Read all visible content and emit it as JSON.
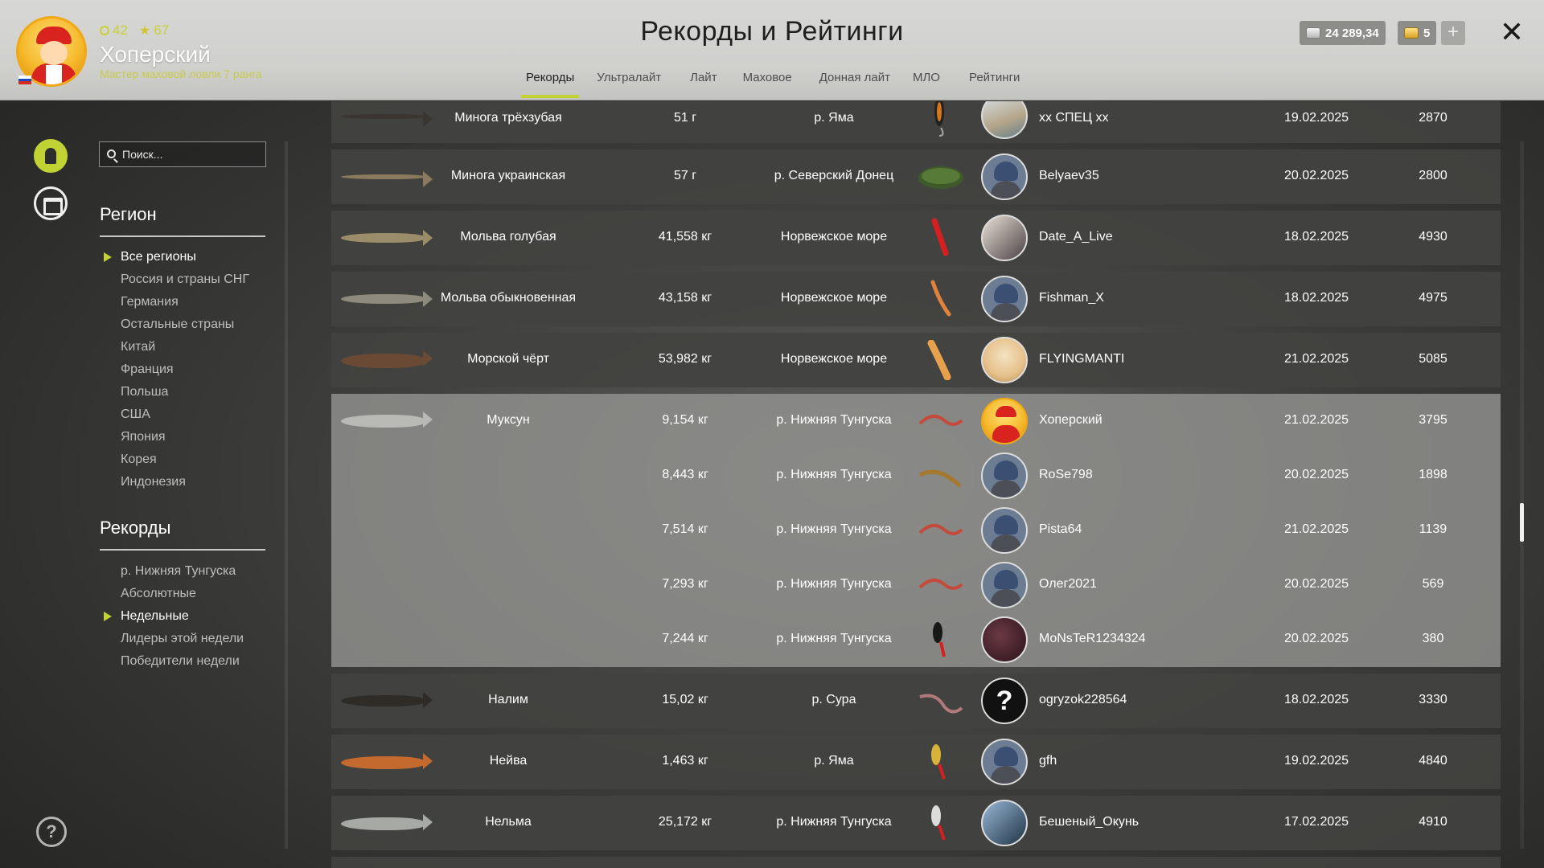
{
  "header": {
    "title": "Рекорды и Рейтинги",
    "player": {
      "level": "42",
      "stars": "67",
      "name": "Хоперский",
      "rank": "Мастер маховой ловли 7 ранга"
    },
    "currency": {
      "silver": "24 289,34",
      "gold": "5"
    },
    "plus_label": "+",
    "close_label": "✕"
  },
  "tabs": [
    "Рекорды",
    "Ультралайт",
    "Лайт",
    "Маховое",
    "Донная лайт",
    "МЛО",
    "Рейтинги"
  ],
  "active_tab": "Рекорды",
  "search": {
    "placeholder": "Поиск..."
  },
  "sidebar": {
    "region_title": "Регион",
    "regions": [
      "Все регионы",
      "Россия и страны СНГ",
      "Германия",
      "Остальные страны",
      "Китай",
      "Франция",
      "Польша",
      "США",
      "Япония",
      "Корея",
      "Индонезия"
    ],
    "records_title": "Рекорды",
    "records": [
      "р. Нижняя Тунгуска",
      "Абсолютные",
      "Недельные",
      "Лидеры этой недели",
      "Победители недели"
    ]
  },
  "help_label": "?",
  "rows": [
    {
      "fish": "Минога трёхзубая",
      "weight": "51 г",
      "place": "р. Яма",
      "player": "xx СПЕЦ xx",
      "date": "19.02.2025",
      "points": "2870"
    },
    {
      "fish": "Минога украинская",
      "weight": "57 г",
      "place": "р. Северский Донец",
      "player": "Belyaev35",
      "date": "20.02.2025",
      "points": "2800"
    },
    {
      "fish": "Мольва голубая",
      "weight": "41,558 кг",
      "place": "Норвежское море",
      "player": "Date_A_Live",
      "date": "18.02.2025",
      "points": "4930"
    },
    {
      "fish": "Мольва обыкновенная",
      "weight": "43,158 кг",
      "place": "Норвежское море",
      "player": "Fishman_X",
      "date": "18.02.2025",
      "points": "4975"
    },
    {
      "fish": "Морской чёрт",
      "weight": "53,982 кг",
      "place": "Норвежское море",
      "player": "FLYINGMANTI",
      "date": "21.02.2025",
      "points": "5085"
    },
    {
      "fish": "Муксун",
      "weight": "9,154 кг",
      "place": "р. Нижняя Тунгуска",
      "player": "Хоперский",
      "date": "21.02.2025",
      "points": "3795"
    },
    {
      "fish": "",
      "weight": "8,443 кг",
      "place": "р. Нижняя Тунгуска",
      "player": "RoSe798",
      "date": "20.02.2025",
      "points": "1898"
    },
    {
      "fish": "",
      "weight": "7,514 кг",
      "place": "р. Нижняя Тунгуска",
      "player": "Pista64",
      "date": "21.02.2025",
      "points": "1139"
    },
    {
      "fish": "",
      "weight": "7,293 кг",
      "place": "р. Нижняя Тунгуска",
      "player": "Олег2021",
      "date": "20.02.2025",
      "points": "569"
    },
    {
      "fish": "",
      "weight": "7,244 кг",
      "place": "р. Нижняя Тунгуска",
      "player": "MoNsTeR1234324",
      "date": "20.02.2025",
      "points": "380"
    },
    {
      "fish": "Налим",
      "weight": "15,02 кг",
      "place": "р. Сура",
      "player": "ogryzok228564",
      "date": "18.02.2025",
      "points": "3330"
    },
    {
      "fish": "Нейва",
      "weight": "1,463 кг",
      "place": "р. Яма",
      "player": "gfh",
      "date": "19.02.2025",
      "points": "4840"
    },
    {
      "fish": "Нельма",
      "weight": "25,172 кг",
      "place": "р. Нижняя Тунгуска",
      "player": "Бешеный_Окунь",
      "date": "17.02.2025",
      "points": "4910"
    }
  ]
}
